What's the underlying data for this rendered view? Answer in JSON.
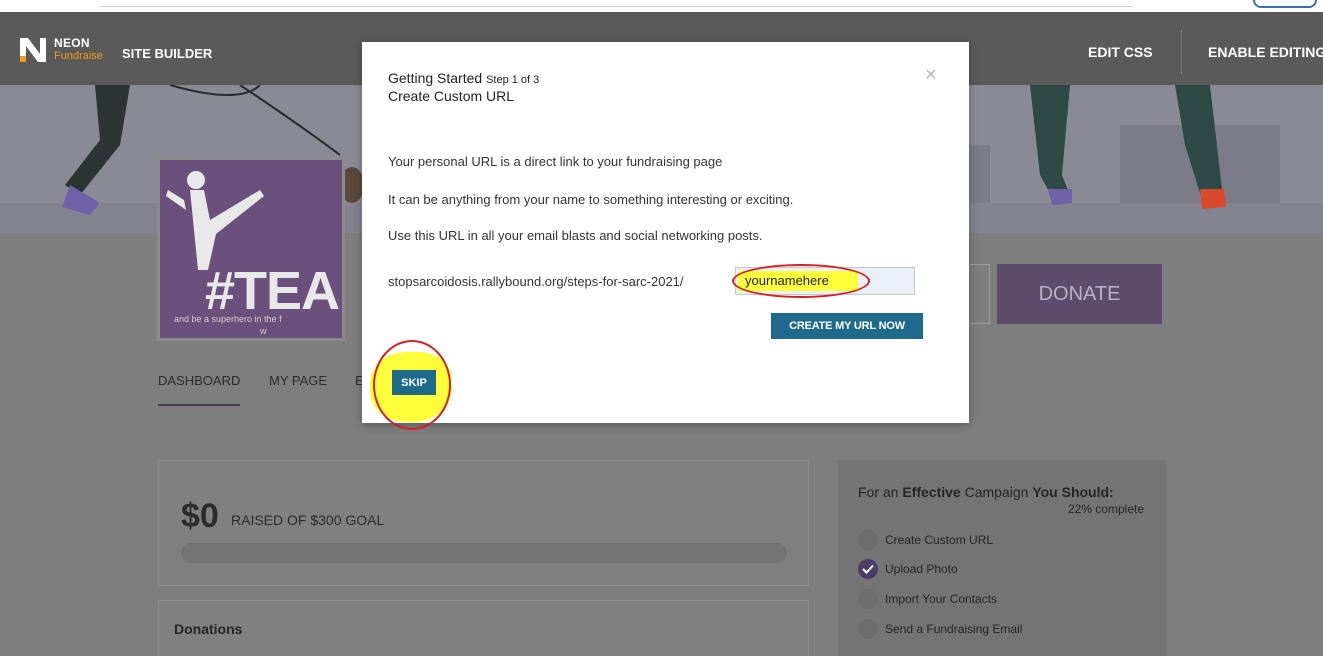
{
  "header": {
    "logo_neon": "NEON",
    "logo_fundraise": "Fundraise",
    "site_builder": "SITE BUILDER",
    "edit_css": "EDIT CSS",
    "enable_editing": "ENABLE EDITING"
  },
  "profile": {
    "avatar_text": "#TEAM",
    "avatar_sub1": "and be a superhero in the f",
    "avatar_sub2": "w",
    "donate_label": "DONATE"
  },
  "tabs": [
    {
      "label": "DASHBOARD"
    },
    {
      "label": "MY PAGE"
    },
    {
      "label": "E"
    }
  ],
  "fundraising": {
    "amount": "$0",
    "goal_text": "RAISED OF $300 GOAL",
    "progress_fraction": 0
  },
  "donations": {
    "title": "Donations"
  },
  "checklist": {
    "heading_pre": "For an ",
    "heading_bold1": "Effective",
    "heading_mid": " Campaign ",
    "heading_bold2": "You Should:",
    "percent": "22% complete",
    "items": [
      {
        "label": "Create Custom URL",
        "done": false
      },
      {
        "label": "Upload Photo",
        "done": true
      },
      {
        "label": "Import Your Contacts",
        "done": false
      },
      {
        "label": "Send a Fundraising Email",
        "done": false
      }
    ]
  },
  "modal": {
    "title": "Getting Started",
    "step": "Step 1 of 3",
    "subtitle": "Create Custom URL",
    "close": "×",
    "para1": "Your personal URL is a direct link to your fundraising page",
    "para2": "It can be anything from your name to something interesting or exciting.",
    "para3": "Use this URL in all your email blasts and social networking posts.",
    "url_prefix": "stopsarcoidosis.rallybound.org/steps-for-sarc-2021/",
    "url_value": "yournamehere",
    "create_button": "CREATE MY URL NOW",
    "skip_button": "SKIP"
  },
  "colors": {
    "header_bg": "#5a5a5a",
    "brand_orange": "#f29b1e",
    "button_teal": "#1f6a8a",
    "donate_purple": "#5c4d6d",
    "annotation_highlight": "#ffff3a",
    "annotation_ring": "#d62020"
  }
}
